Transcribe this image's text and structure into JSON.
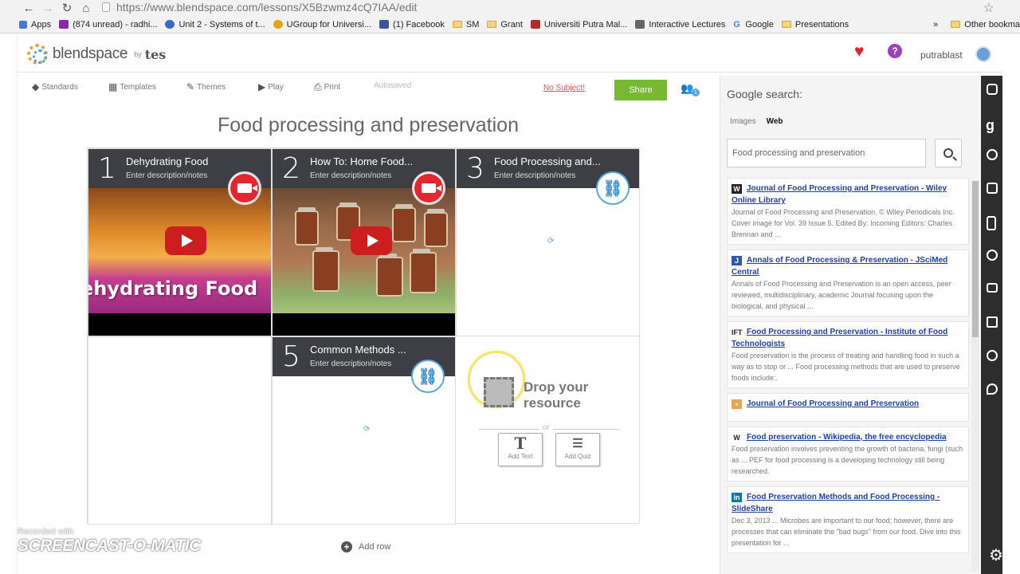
{
  "browser": {
    "url": "https://www.blendspace.com/lessons/X5Bzwmz4cQ7IAA/edit",
    "bookmarks": [
      "Apps",
      "(874 unread) - radhi...",
      "Unit 2 - Systems of t...",
      "UGroup for Universi...",
      "(1) Facebook",
      "SM",
      "Grant",
      "Universiti Putra Mal...",
      "Interactive Lectures",
      "Google",
      "Presentations"
    ],
    "more_bookmarks": "»",
    "other_bookmarks": "Other bookma"
  },
  "header": {
    "logo_text": "blendspace",
    "logo_by": "by",
    "logo_tes": "tes",
    "username": "putrablast"
  },
  "toolbar": {
    "standards": "Standards",
    "templates": "Templates",
    "themes": "Themes",
    "play": "Play",
    "print": "Print",
    "autosaved": "Autosaved",
    "no_subject": "No Subject!",
    "share": "Share",
    "collab_count": "1"
  },
  "lesson": {
    "title": "Food processing and preservation",
    "add_row": "Add row",
    "tiles": [
      {
        "num": "1",
        "title": "Dehydrating Food",
        "desc": "Enter description/notes",
        "type": "video",
        "thumb_text": "ehydrating Food"
      },
      {
        "num": "2",
        "title": "How To: Home Food...",
        "desc": "Enter description/notes",
        "type": "video"
      },
      {
        "num": "3",
        "title": "Food Processing and...",
        "desc": "Enter description/notes",
        "type": "link"
      },
      {
        "num": "5",
        "title": "Common Methods ...",
        "desc": "Enter description/notes",
        "type": "link"
      }
    ],
    "drop": {
      "line1": "Drop your",
      "line2": "resource",
      "or": "or",
      "add_text": "Add Text",
      "add_quiz": "Add Quiz"
    }
  },
  "google": {
    "title": "Google search:",
    "tab_images": "Images",
    "tab_web": "Web",
    "query": "Food processing and preservation",
    "results": [
      {
        "icon": "W",
        "icon_color": "#222222",
        "title": "Journal of Food Processing and Preservation - Wiley Online Library",
        "snippet": "Journal of Food Processing and Preservation. © Wiley Periodicals Inc. Cover image for Vol. 39 Issue 5. Edited By: Incoming Editors: Charles Brennan and ..."
      },
      {
        "icon": "J",
        "icon_color": "#2a5aa8",
        "title": "Annals of Food Processing & Preservation - JSciMed Central",
        "snippet": "Annals of Food Processing and Preservation is an open access, peer reviewed, multidisciplinary, academic Journal focusing upon the biological, and physical ..."
      },
      {
        "icon": "IFT",
        "icon_color": "#ffffff",
        "title": "Food Processing and Preservation - Institute of Food Technologists",
        "snippet": "Food preservation is the process of treating and handling food in such a way as to stop or ... Food processing methods that are used to preserve foods include:."
      },
      {
        "icon": "•",
        "icon_color": "#e8a45a",
        "title": "Journal of Food Processing and Preservation",
        "snippet": ""
      },
      {
        "icon": "W",
        "icon_color": "#ffffff",
        "title": "Food preservation - Wikipedia, the free encyclopedia",
        "snippet": "Food preservation involves preventing the growth of bacteria, fungi (such as ... PEF for food processing is a developing technology still being researched."
      },
      {
        "icon": "in",
        "icon_color": "#0e76a8",
        "title": "Food Preservation Methods and Food Processing - SlideShare",
        "snippet": "Dec 3, 2013 ... Microbes are important to our food; however, there are processes that can eliminate the \"bad bugs\" from our food. Dive into this presentation for ..."
      }
    ]
  },
  "watermark": {
    "line1": "Recorded with",
    "line2": "SCREENCAST-O-MATIC"
  }
}
